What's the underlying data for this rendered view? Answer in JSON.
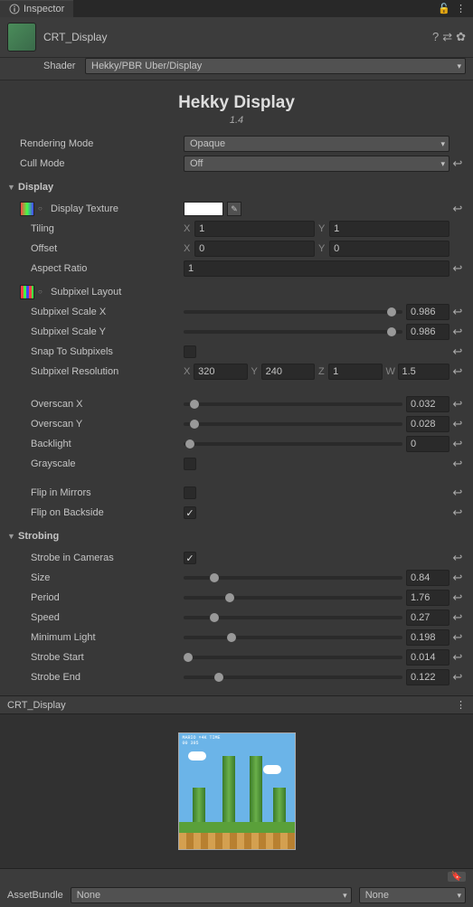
{
  "tab": "Inspector",
  "lockIcon": "lock",
  "menuIcon": "⋮",
  "material": {
    "name": "CRT_Display",
    "shaderLabel": "Shader",
    "shader": "Hekky/PBR Uber/Display"
  },
  "title": "Hekky Display",
  "version": "1.4",
  "renderingMode": {
    "label": "Rendering Mode",
    "value": "Opaque"
  },
  "cullMode": {
    "label": "Cull Mode",
    "value": "Off"
  },
  "display": {
    "header": "Display",
    "texture": {
      "label": "Display Texture"
    },
    "tiling": {
      "label": "Tiling",
      "x": "1",
      "y": "1"
    },
    "offset": {
      "label": "Offset",
      "x": "0",
      "y": "0"
    },
    "aspect": {
      "label": "Aspect Ratio",
      "value": "1"
    },
    "subpixelLayout": {
      "label": "Subpixel Layout"
    },
    "subScaleX": {
      "label": "Subpixel Scale X",
      "value": "0.986",
      "pct": 95
    },
    "subScaleY": {
      "label": "Subpixel Scale Y",
      "value": "0.986",
      "pct": 95
    },
    "snap": {
      "label": "Snap To Subpixels"
    },
    "subRes": {
      "label": "Subpixel Resolution",
      "x": "320",
      "y": "240",
      "z": "1",
      "w": "1.5"
    },
    "overscanX": {
      "label": "Overscan X",
      "value": "0.032",
      "pct": 5
    },
    "overscanY": {
      "label": "Overscan Y",
      "value": "0.028",
      "pct": 5
    },
    "backlight": {
      "label": "Backlight",
      "value": "0",
      "pct": 3
    },
    "grayscale": {
      "label": "Grayscale"
    },
    "flipMirrors": {
      "label": "Flip in Mirrors"
    },
    "flipBackside": {
      "label": "Flip on Backside"
    }
  },
  "strobing": {
    "header": "Strobing",
    "cameras": {
      "label": "Strobe in Cameras"
    },
    "size": {
      "label": "Size",
      "value": "0.84",
      "pct": 14
    },
    "period": {
      "label": "Period",
      "value": "1.76",
      "pct": 21
    },
    "speed": {
      "label": "Speed",
      "value": "0.27",
      "pct": 14
    },
    "minLight": {
      "label": "Minimum Light",
      "value": "0.198",
      "pct": 22
    },
    "strobeStart": {
      "label": "Strobe Start",
      "value": "0.014",
      "pct": 2
    },
    "strobeEnd": {
      "label": "Strobe End",
      "value": "0.122",
      "pct": 16
    }
  },
  "preview": {
    "title": "CRT_Display"
  },
  "assetBundle": {
    "label": "AssetBundle",
    "value": "None",
    "variant": "None"
  },
  "axes": {
    "x": "X",
    "y": "Y",
    "z": "Z",
    "w": "W"
  }
}
